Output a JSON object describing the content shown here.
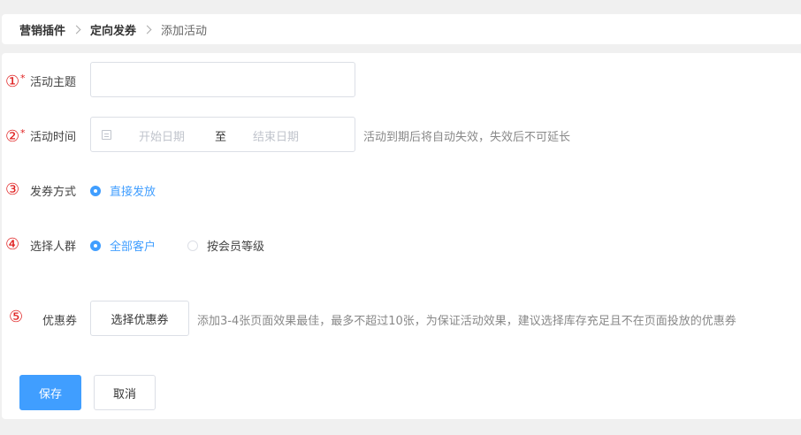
{
  "breadcrumb": {
    "items": [
      "营销插件",
      "定向发券",
      "添加活动"
    ]
  },
  "form": {
    "theme": {
      "number": "①",
      "required_mark": "*",
      "label": "活动主题",
      "value": "",
      "placeholder": ""
    },
    "time": {
      "number": "②",
      "required_mark": "*",
      "label": "活动时间",
      "start_placeholder": "开始日期",
      "range_separator": "至",
      "end_placeholder": "结束日期",
      "hint": "活动到期后将自动失效，失效后不可延长"
    },
    "issue_method": {
      "number": "③",
      "label": "发券方式",
      "options": [
        {
          "label": "直接发放",
          "selected": true
        }
      ]
    },
    "audience": {
      "number": "④",
      "label": "选择人群",
      "options": [
        {
          "label": "全部客户",
          "selected": true
        },
        {
          "label": "按会员等级",
          "selected": false
        }
      ]
    },
    "coupon": {
      "number": "⑤",
      "label": "优惠券",
      "button_label": "选择优惠券",
      "hint": "添加3-4张页面效果最佳，最多不超过10张，为保证活动效果，建议选择库存充足且不在页面投放的优惠券"
    }
  },
  "actions": {
    "save_label": "保存",
    "cancel_label": "取消"
  },
  "colors": {
    "primary": "#409eff",
    "annotation_red": "#e02020",
    "hint_gray": "#888888"
  }
}
